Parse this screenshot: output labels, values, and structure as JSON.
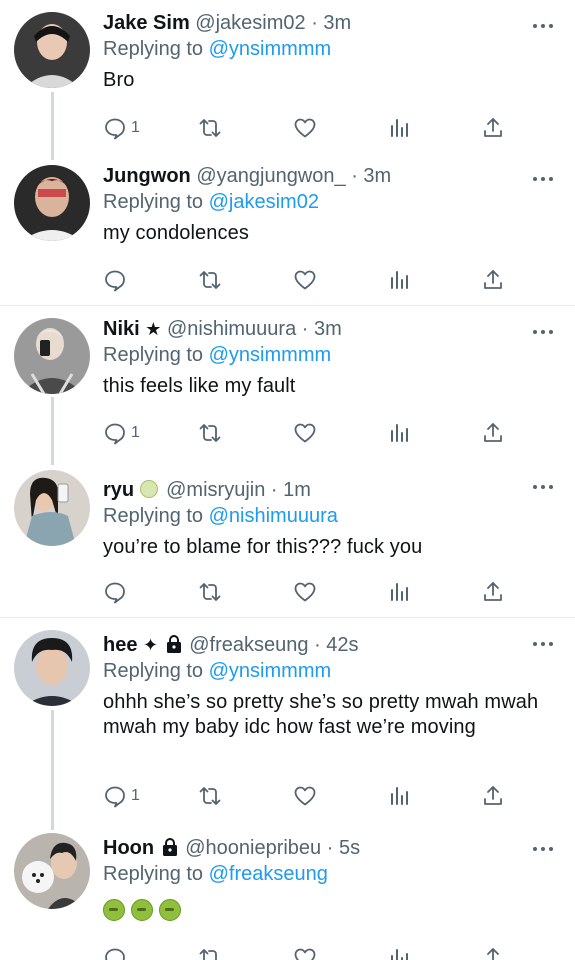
{
  "tweets": [
    {
      "name": "Jake Sim",
      "badges": "",
      "handle": "@jakesim02",
      "time": "· 3m",
      "replying_prefix": "Replying to",
      "replying_to": "@ynsimmmm",
      "text": "Bro",
      "reply_count": "1",
      "avatar_icon": "avatar-jake"
    },
    {
      "name": "Jungwon",
      "badges": "",
      "handle": "@yangjungwon_",
      "time": "· 3m",
      "replying_prefix": "Replying to",
      "replying_to": "@jakesim02",
      "text": "my condolences",
      "reply_count": "",
      "avatar_icon": "avatar-jungwon"
    },
    {
      "name": "Niki",
      "badges": "★",
      "handle": "@nishimuuura",
      "time": "· 3m",
      "replying_prefix": "Replying to",
      "replying_to": "@ynsimmmm",
      "text": "this feels like my fault",
      "reply_count": "1",
      "avatar_icon": "avatar-niki"
    },
    {
      "name": "ryu",
      "badges": "",
      "handle": "@misryujin",
      "time": "· 1m",
      "replying_prefix": "Replying to",
      "replying_to": "@nishimuuura",
      "text": "you’re to blame for this??? fuck you",
      "reply_count": "",
      "avatar_icon": "avatar-ryu"
    },
    {
      "name": "hee",
      "badges": "✦",
      "handle": "@freakseung",
      "time": "· 42s",
      "replying_prefix": "Replying to",
      "replying_to": "@ynsimmmm",
      "text": "ohhh she’s so pretty she’s so pretty mwah mwah mwah my baby idc how fast we’re moving",
      "reply_count": "1",
      "avatar_icon": "avatar-hee"
    },
    {
      "name": "Hoon",
      "badges": "",
      "handle": "@hooniepribeu",
      "time": "· 5s",
      "replying_prefix": "Replying to",
      "replying_to": "@freakseung",
      "text": "",
      "reply_count": "",
      "avatar_icon": "avatar-hoon"
    }
  ],
  "icons": {
    "reply": "reply-icon",
    "retweet": "retweet-icon",
    "like": "heart-icon",
    "views": "views-icon",
    "share": "share-icon",
    "more": "more-icon"
  },
  "colors": {
    "link": "#1d9bf0",
    "muted": "#536471",
    "text": "#0f1419",
    "divider": "#e6ecf0",
    "thread_line": "#cfd9de"
  }
}
